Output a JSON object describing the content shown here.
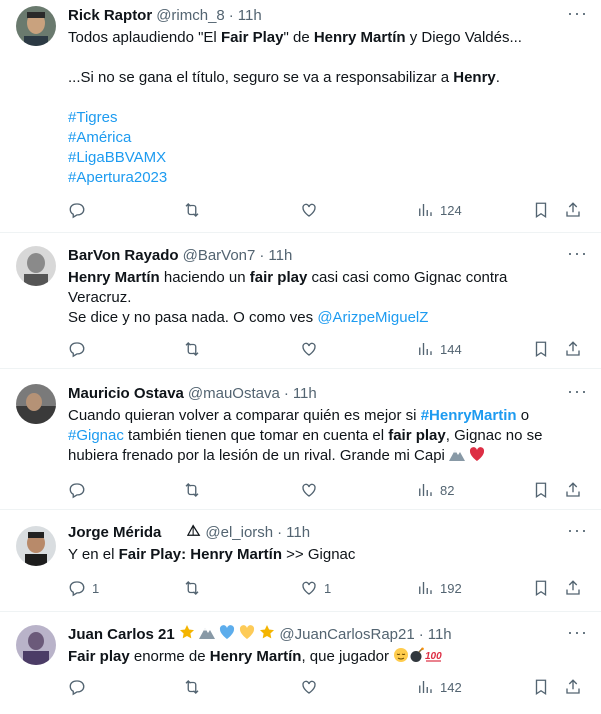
{
  "tweets": [
    {
      "name": "Rick Raptor",
      "handle": "@rimch_8",
      "sep": "·",
      "time": "11h",
      "more": "···",
      "line1_a": "Todos aplaudiendo \"El ",
      "line1_b": "Fair Play",
      "line1_c": "\" de ",
      "line1_d": "Henry Martín",
      "line1_e": " y Diego Valdés...",
      "line2_a": "...Si no se gana el título, seguro se va a responsabilizar a ",
      "line2_b": "Henry",
      "line2_c": ".",
      "hashtags": [
        "#Tigres",
        "#América",
        "#LigaBBVAMX",
        "#Apertura2023"
      ],
      "views": "124"
    },
    {
      "name": "BarVon Rayado",
      "handle": "@BarVon7",
      "sep": "·",
      "time": "11h",
      "more": "···",
      "t_a": "Henry Martín",
      "t_b": " haciendo un ",
      "t_c": "fair play",
      "t_d": " casi casi como Gignac contra",
      "t_e": "Veracruz.",
      "t_f": "Se dice y no pasa nada. O como ves ",
      "t_g": "@ArizpeMiguelZ",
      "views": "144"
    },
    {
      "name": "Mauricio Ostava",
      "handle": "@mauOstava",
      "sep": "·",
      "time": "11h",
      "more": "···",
      "t_a": "Cuando quieran volver a comparar quién es mejor si ",
      "t_b": "#HenryMartin",
      "t_c": " o",
      "t_d": "#Gignac",
      "t_e": " también tienen que tomar en cuenta el ",
      "t_f": "fair play",
      "t_g": ", Gignac no se",
      "t_h": "hubiera frenado por la lesión de un rival.  Grande mi Capi ",
      "views": "82"
    },
    {
      "name": "Jorge Mérida",
      "handle": "@el_iorsh",
      "sep": "·",
      "time": "11h",
      "more": "···",
      "t_a": "Y en el ",
      "t_b": "Fair Play: Henry Martín",
      "t_c": " >> Gignac",
      "replies": "1",
      "likes": "1",
      "views": "192"
    },
    {
      "name": "Juan Carlos 21",
      "handle": "@JuanCarlosRap21",
      "sep": "·",
      "time": "11h",
      "more": "···",
      "t_a": "Fair play",
      "t_b": " enorme de ",
      "t_c": "Henry Martín",
      "t_d": ", que jugador ",
      "views": "142"
    }
  ],
  "colors": {
    "link": "#1d9bf0",
    "muted": "#536471",
    "text": "#0f1419",
    "divider": "#eff3f4"
  },
  "icons": [
    "reply-icon",
    "retweet-icon",
    "like-icon",
    "views-icon",
    "bookmark-icon",
    "share-icon",
    "more-icon"
  ]
}
